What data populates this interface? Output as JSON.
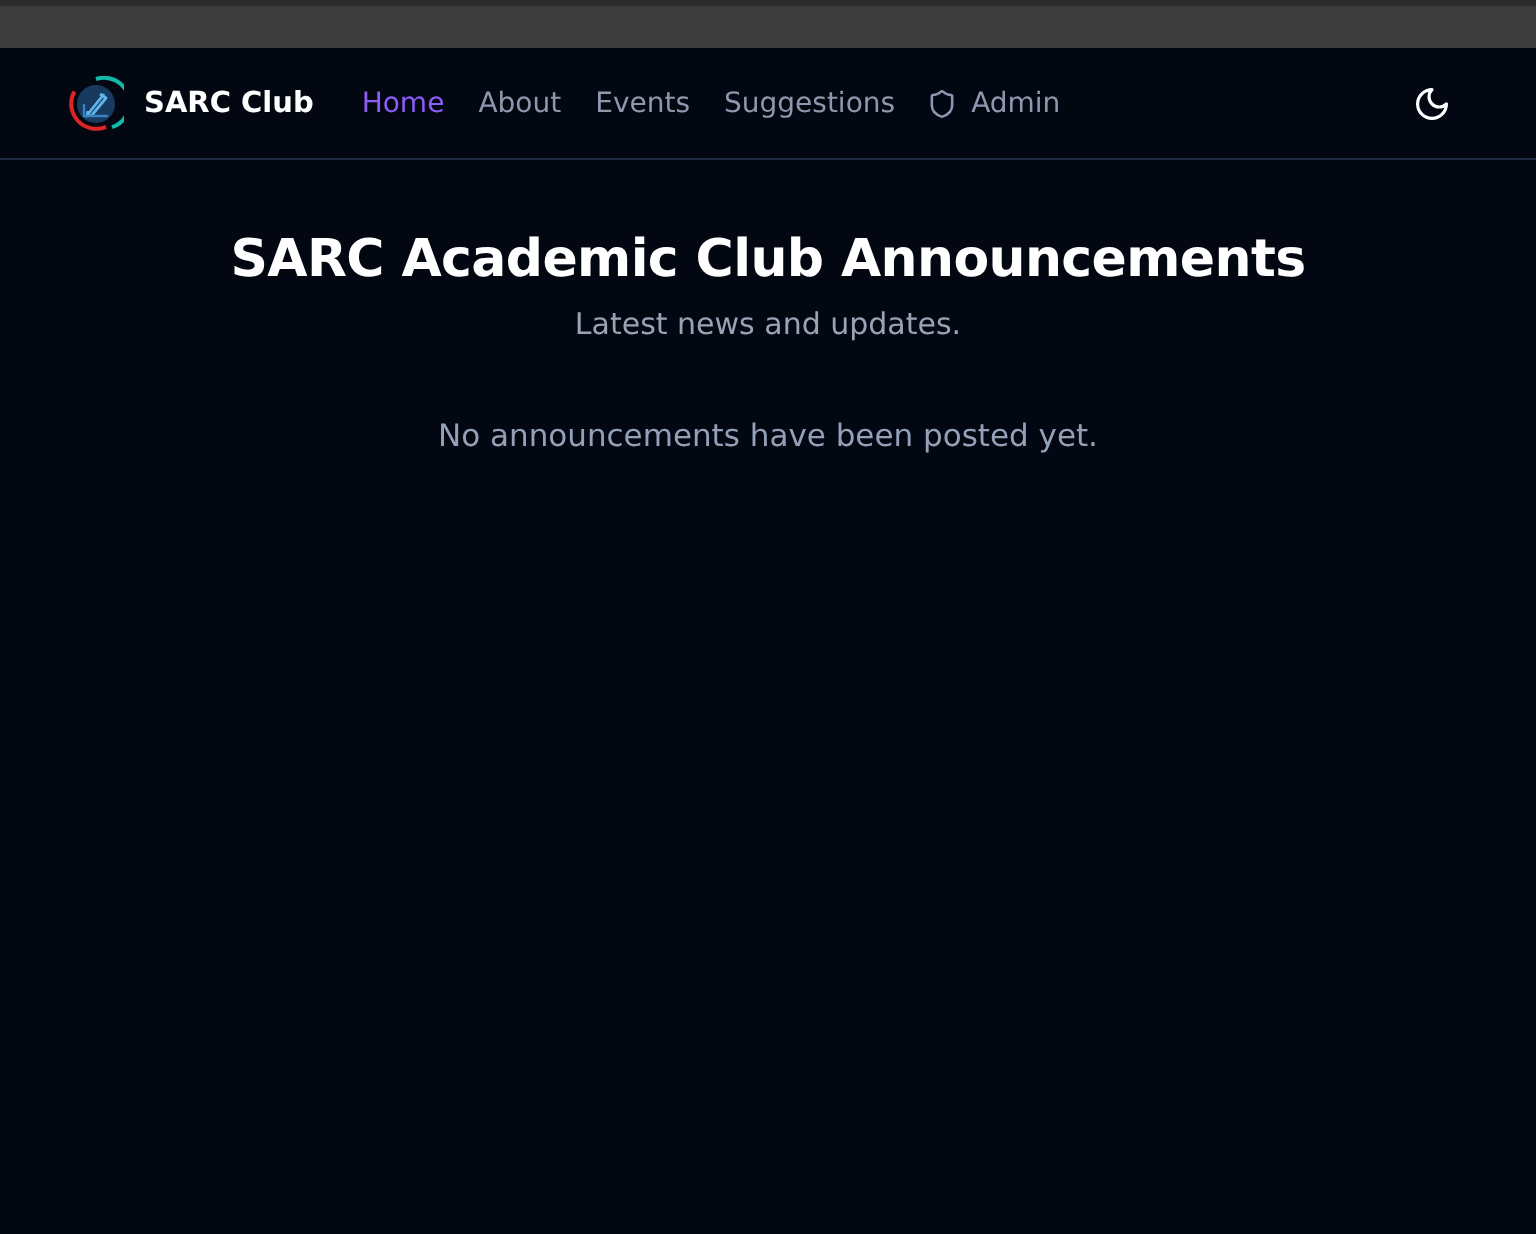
{
  "navbar": {
    "brand": "SARC Club",
    "links": [
      {
        "label": "Home",
        "selected": true,
        "kind": "plain"
      },
      {
        "label": "About",
        "selected": false,
        "kind": "plain"
      },
      {
        "label": "Events",
        "selected": false,
        "kind": "plain"
      },
      {
        "label": "Suggestions",
        "selected": false,
        "kind": "plain"
      },
      {
        "label": "Admin",
        "selected": false,
        "kind": "shield"
      }
    ]
  },
  "page": {
    "title": "SARC Academic Club Announcements",
    "subtitle": "Latest news and updates.",
    "empty_message": "No announcements have been posted yet."
  }
}
